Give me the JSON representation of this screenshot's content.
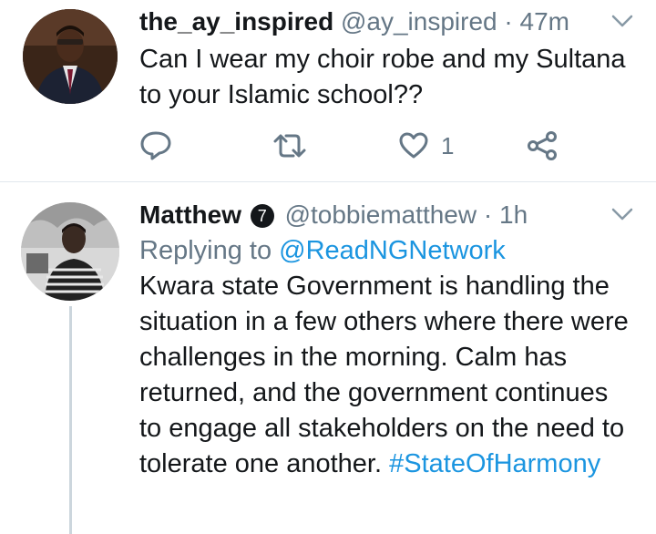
{
  "tweets": [
    {
      "display_name": "the_ay_inspired",
      "handle": "@ay_inspired",
      "sep": " · ",
      "time": "47m",
      "text": "Can I wear my choir robe and my Sultana to your Islamic school??",
      "like_count": "1",
      "icons": [
        "caret-down-icon",
        "reply-icon",
        "retweet-icon",
        "heart-icon",
        "share-icon"
      ]
    },
    {
      "display_name": "Matthew",
      "verified_glyph": "7",
      "handle": "@tobbiematthew",
      "sep": " · ",
      "time": "1h",
      "replying_prefix": "Replying to ",
      "replying_to": "@ReadNGNetwork",
      "text": "Kwara state Government is handling the situation in a few others where there were challenges in the morning. Calm has returned, and the government continues to engage all stakeholders on the need to tolerate one another.",
      "hashtag": "#StateOfHarmony"
    }
  ],
  "colors": {
    "text": "#14171a",
    "secondary": "#657786",
    "link": "#1b95e0",
    "divider": "#e1e8ed",
    "thread_line": "#ccd6dd"
  }
}
